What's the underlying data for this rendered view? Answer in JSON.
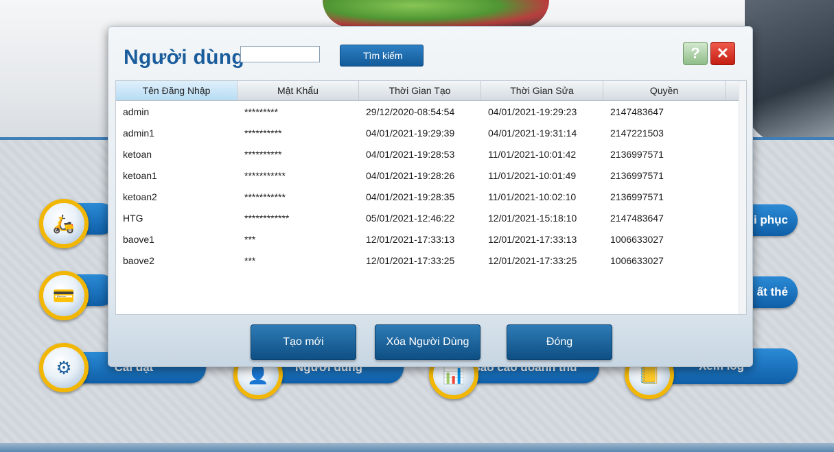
{
  "background": {
    "menu": [
      {
        "label": "i phục",
        "icon": "scooter-icon"
      },
      {
        "label": "ất thẻ",
        "icon": "card-icon"
      },
      {
        "label": "Cài đặt",
        "icon": "gear-icon"
      },
      {
        "label": "Người dùng",
        "icon": "user-icon"
      },
      {
        "label": "Báo cáo doanh thu",
        "icon": "report-icon"
      },
      {
        "label": "Xem log",
        "icon": "log-icon"
      }
    ]
  },
  "dialog": {
    "title": "Người dùng",
    "search": {
      "value": "",
      "placeholder": "",
      "button_label": "Tìm kiếm"
    },
    "help_label": "?",
    "close_label": "✕",
    "table": {
      "columns": [
        "Tên Đăng Nhập",
        "Mật Khẩu",
        "Thời Gian Tạo",
        "Thời Gian Sửa",
        "Quyền"
      ],
      "rows": [
        [
          "admin",
          "*********",
          "29/12/2020-08:54:54",
          "04/01/2021-19:29:23",
          "2147483647"
        ],
        [
          "admin1",
          "**********",
          "04/01/2021-19:29:39",
          "04/01/2021-19:31:14",
          "2147221503"
        ],
        [
          "ketoan",
          "**********",
          "04/01/2021-19:28:53",
          "11/01/2021-10:01:42",
          "2136997571"
        ],
        [
          "ketoan1",
          "***********",
          "04/01/2021-19:28:26",
          "11/01/2021-10:01:49",
          "2136997571"
        ],
        [
          "ketoan2",
          "***********",
          "04/01/2021-19:28:35",
          "11/01/2021-10:02:10",
          "2136997571"
        ],
        [
          "HTG",
          "************",
          "05/01/2021-12:46:22",
          "12/01/2021-15:18:10",
          "2147483647"
        ],
        [
          "baove1",
          "***",
          "12/01/2021-17:33:13",
          "12/01/2021-17:33:13",
          "1006633027"
        ],
        [
          "baove2",
          "***",
          "12/01/2021-17:33:25",
          "12/01/2021-17:33:25",
          "1006633027"
        ]
      ]
    },
    "buttons": {
      "create": "Tạo mới",
      "delete": "Xóa Người Dùng",
      "close": "Đóng"
    }
  },
  "colors": {
    "accent": "#1b5d9c",
    "button": "#135a98",
    "close": "#c41e12",
    "help": "#8fbc88",
    "gold": "#f2b705"
  }
}
